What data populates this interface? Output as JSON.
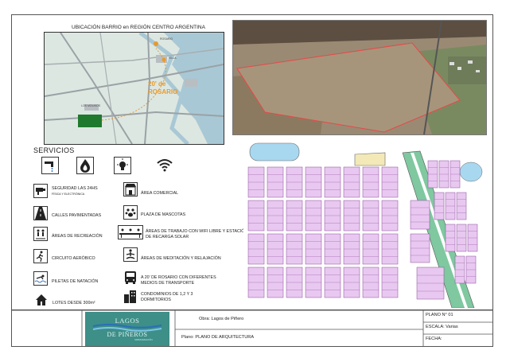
{
  "map": {
    "title": "UBICACIÓN BARRIO en REGIÓN CENTRO ARGENTINA",
    "distance_label_1": "20' de",
    "distance_label_2": "ROSARIO",
    "place_top": "ROSARIO",
    "place_mid": "VILLA",
    "place_left": "LOS MOLINOS"
  },
  "services": {
    "title": "SERVICIOS",
    "top_icons": [
      "faucet-icon",
      "gas-flame-icon",
      "lightbulb-icon",
      "wifi-icon"
    ],
    "left_items": [
      {
        "icon": "security-camera-icon",
        "label": "SEGURIDAD LAS 24HS",
        "sublabel": "FÍSICA Y ELECTRÓNICA"
      },
      {
        "icon": "paved-road-icon",
        "label": "CALLES PAVIMENTADAS"
      },
      {
        "icon": "playground-icon",
        "label": "ÁREAS DE RECREACIÓN"
      },
      {
        "icon": "running-icon",
        "label": "CIRCUITO AERÓBICO"
      },
      {
        "icon": "swimming-pool-icon",
        "label": "PILETAS DE NATACIÓN"
      },
      {
        "icon": "house-icon",
        "label": "LOTES DESDE 300m²"
      }
    ],
    "right_items": [
      {
        "icon": "shop-icon",
        "label": "ÁREA COMERCIAL"
      },
      {
        "icon": "pets-icon",
        "label": "PLAZA DE MASCOTAS"
      },
      {
        "icon": "coworking-icon",
        "label": "ÁREAS DE TRABAJO CON WIFI LIBRE Y ESTACIÓN",
        "label2": "DE RECARGA SOLAR"
      },
      {
        "icon": "meditation-icon",
        "label": "ÁREAS DE MEDITACIÓN Y RELAJACIÓN"
      },
      {
        "icon": "bus-icon",
        "label": "A 20' DE ROSARIO CON DIFERENTES",
        "label2": "MEDIOS DE TRANSPORTE"
      },
      {
        "icon": "buildings-icon",
        "label": "CONDOMINIOS DE 1,2 Y 3",
        "label2": "DORMITORIOS"
      }
    ]
  },
  "titleblock": {
    "logo_line1": "LAGOS",
    "logo_line2": "DE PIÑEROS",
    "logo_tag": "URBANIZACIÓN",
    "obra": "Obra: Lagos de Piñero",
    "plano": "Plano: PLANO DE ARQUITECTURA",
    "plano_num": "PLANO N° 01",
    "escala": "ESCALA: Varias",
    "fecha": "FECHA:"
  },
  "colors": {
    "lot_fill": "#e8c8f0",
    "lot_stroke": "#8a4a9a",
    "green_strip": "#7fc8a0",
    "water": "#a8d8f0",
    "brand_teal": "#3d8f88",
    "aerial_outline": "#e84848"
  }
}
